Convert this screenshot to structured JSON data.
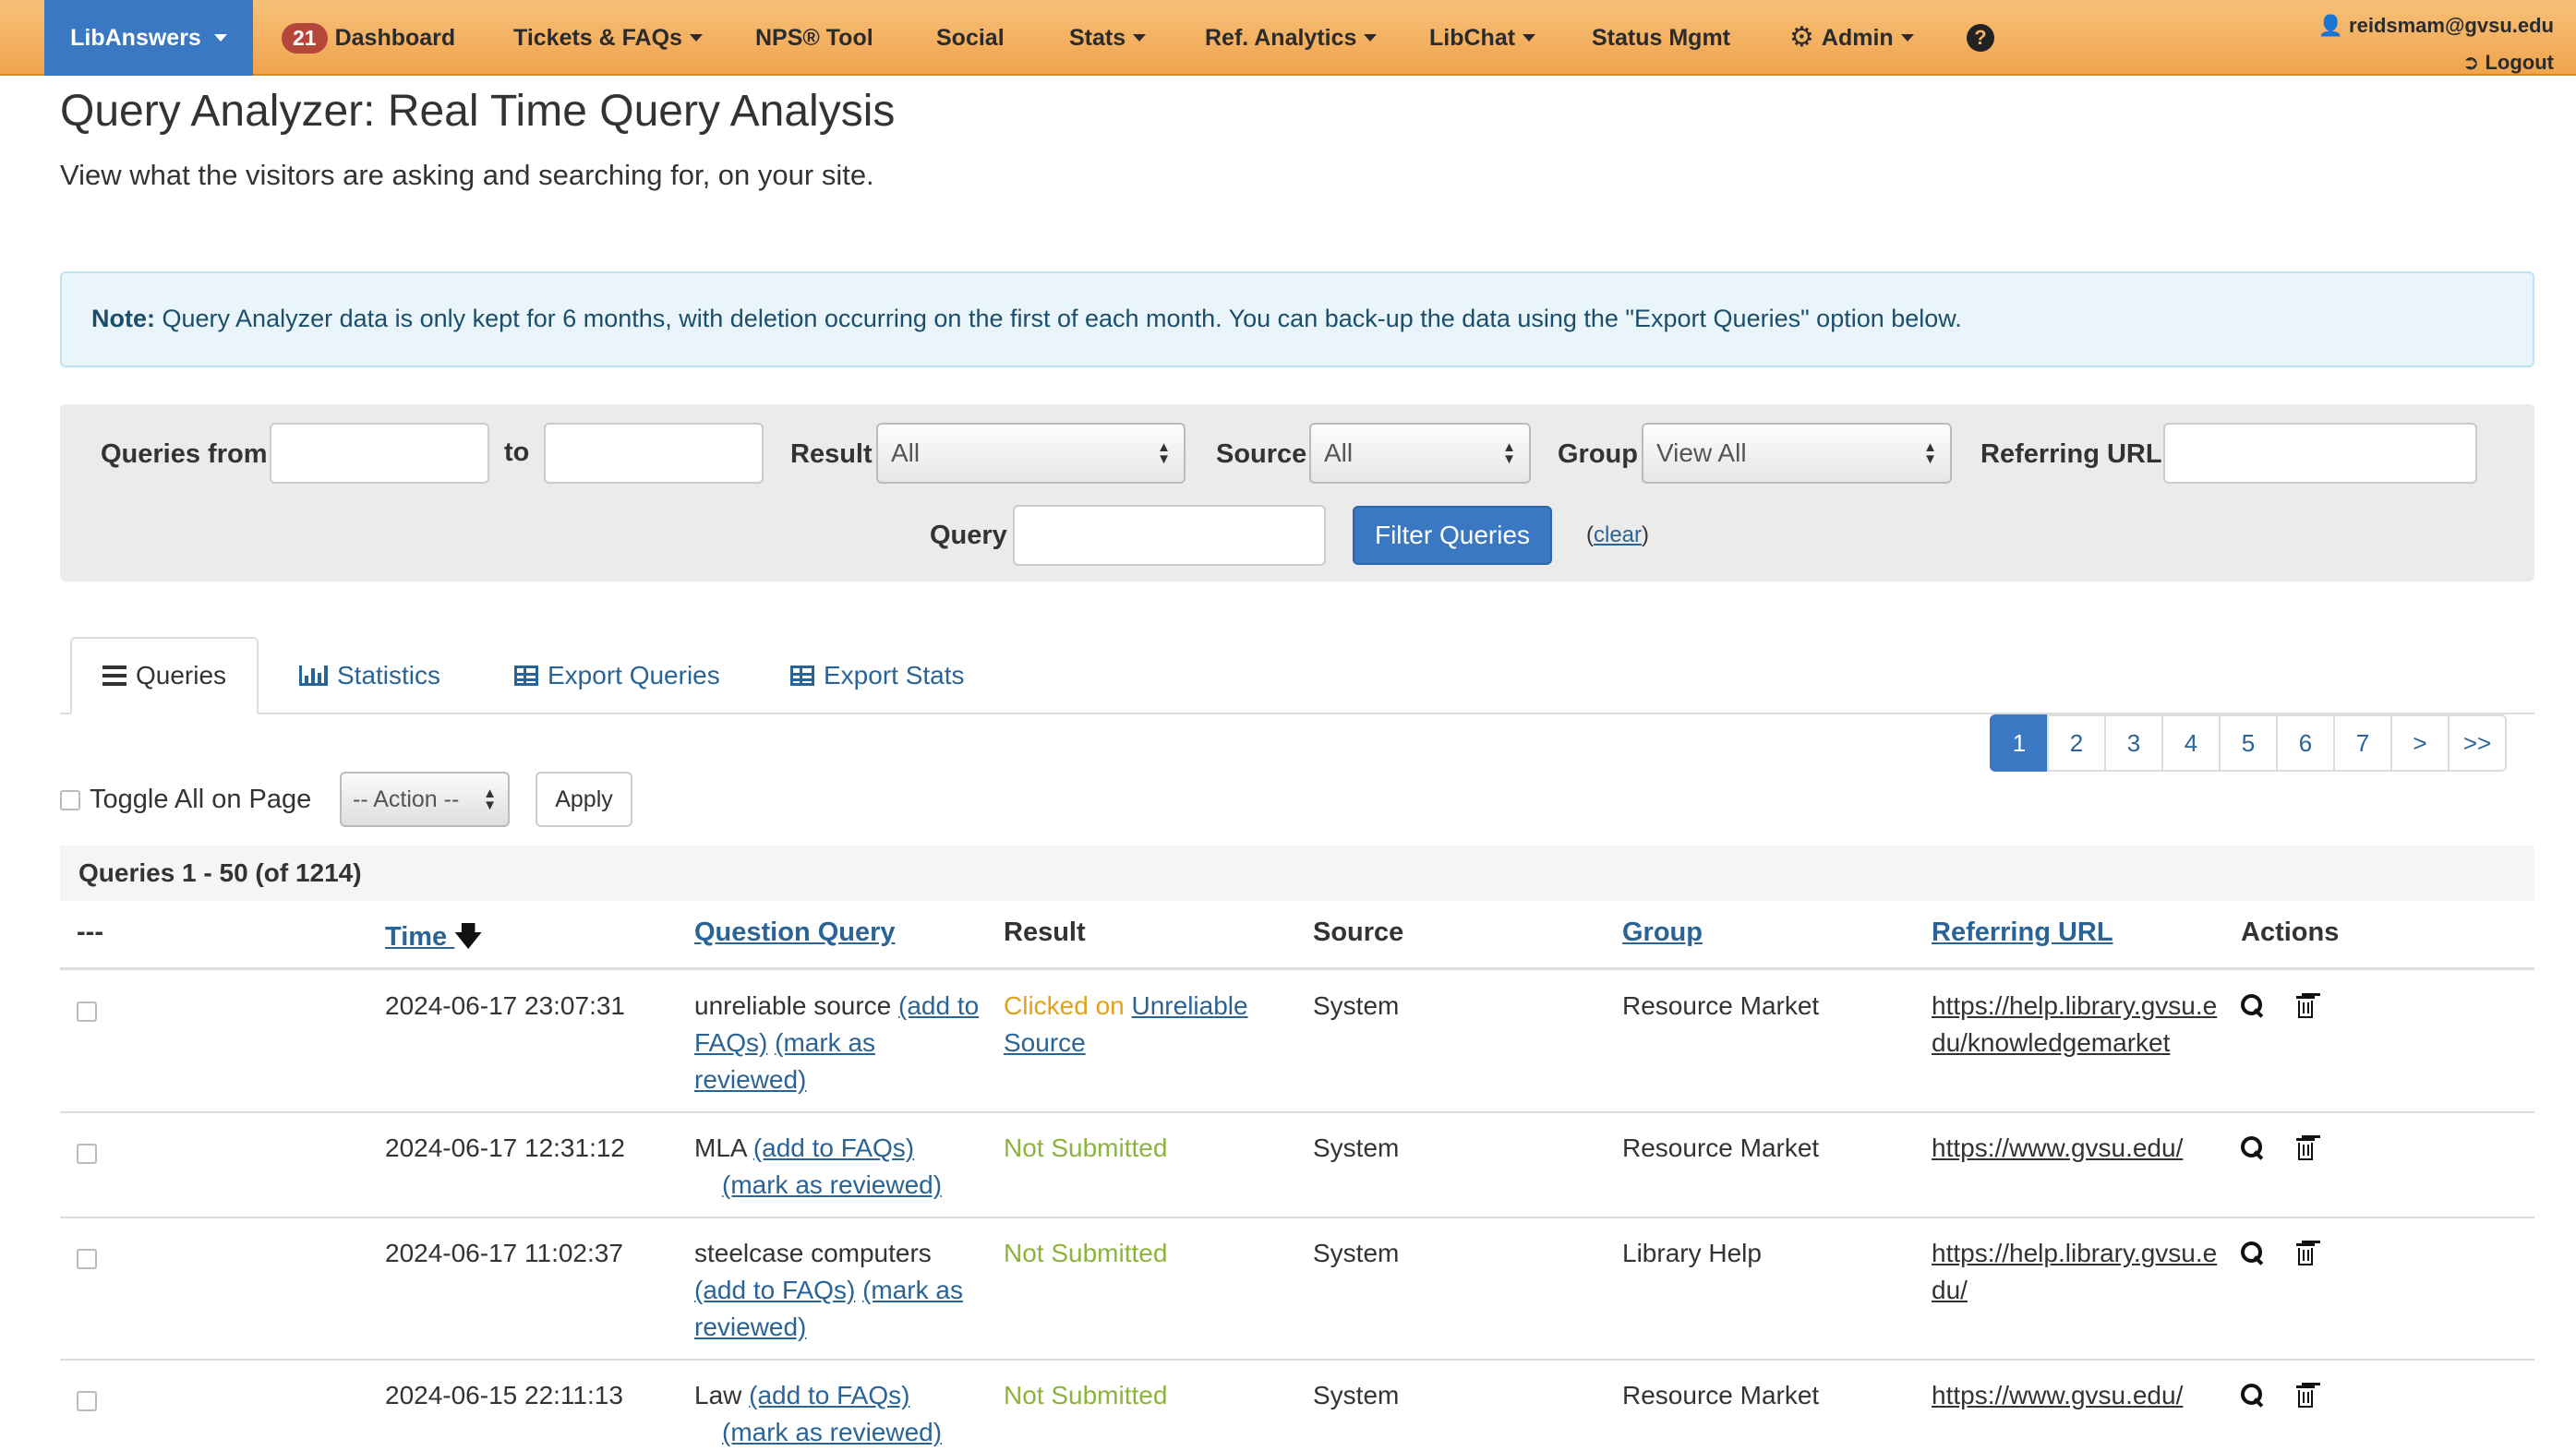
{
  "navbar": {
    "brand": "LibAnswers",
    "dashboard_badge": "21",
    "items": [
      {
        "label": "Dashboard"
      },
      {
        "label": "Tickets & FAQs"
      },
      {
        "label": "NPS® Tool"
      },
      {
        "label": "Social"
      },
      {
        "label": "Stats"
      },
      {
        "label": "Ref. Analytics"
      },
      {
        "label": "LibChat"
      },
      {
        "label": "Status Mgmt"
      },
      {
        "label": "Admin"
      }
    ],
    "help_symbol": "?",
    "user_email": "reidsmam@gvsu.edu",
    "logout_label": "Logout"
  },
  "page": {
    "title": "Query Analyzer: Real Time Query Analysis",
    "subtitle": "View what the visitors are asking and searching for, on your site."
  },
  "note": {
    "label": "Note:",
    "text": " Query Analyzer data is only kept for 6 months, with deletion occurring on the first of each month. You can back-up the data using the \"Export Queries\" option below."
  },
  "filter": {
    "queries_from_label": "Queries from",
    "from_value": "",
    "to_label": "to",
    "to_value": "",
    "result_label": "Result",
    "result_value": "All",
    "source_label": "Source",
    "source_value": "All",
    "group_label": "Group",
    "group_value": "View All",
    "referring_url_label": "Referring URL",
    "referring_url_value": "",
    "query_label": "Query",
    "query_value": "",
    "filter_button": "Filter Queries",
    "clear_open": "(",
    "clear_label": "clear",
    "clear_close": ")"
  },
  "tabs": [
    {
      "label": "Queries",
      "active": true
    },
    {
      "label": "Statistics",
      "active": false
    },
    {
      "label": "Export Queries",
      "active": false
    },
    {
      "label": "Export Stats",
      "active": false
    }
  ],
  "pagination": {
    "pages": [
      "1",
      "2",
      "3",
      "4",
      "5",
      "6",
      "7",
      ">",
      ">>"
    ],
    "active": "1"
  },
  "toolbar": {
    "toggle_all_label": "Toggle All on Page",
    "action_value": "-- Action --",
    "apply_label": "Apply"
  },
  "table": {
    "summary": "Queries 1 - 50 (of 1214)",
    "headers": {
      "select": "---",
      "time": "Time",
      "question_query": "Question Query",
      "result": "Result",
      "source": "Source",
      "group": "Group",
      "referring_url": "Referring URL",
      "actions": "Actions"
    },
    "add_to_faqs": "(add to FAQs)",
    "mark_reviewed": "(mark as reviewed)",
    "rows": [
      {
        "time": "2024-06-17 23:07:31",
        "query": "unreliable source",
        "result_prefix": "Clicked on",
        "result_link": "Unreliable Source",
        "result_status": "clicked",
        "source": "System",
        "group": "Resource Market",
        "referring_url": "https://help.library.gvsu.edu/knowledgemarket"
      },
      {
        "time": "2024-06-17 12:31:12",
        "query": "MLA",
        "result_prefix": "Not Submitted",
        "result_link": "",
        "result_status": "not-submitted",
        "source": "System",
        "group": "Resource Market",
        "referring_url": "https://www.gvsu.edu/"
      },
      {
        "time": "2024-06-17 11:02:37",
        "query": "steelcase computers",
        "result_prefix": "Not Submitted",
        "result_link": "",
        "result_status": "not-submitted",
        "source": "System",
        "group": "Library Help",
        "referring_url": "https://help.library.gvsu.edu/"
      },
      {
        "time": "2024-06-15 22:11:13",
        "query": "Law",
        "result_prefix": "Not Submitted",
        "result_link": "",
        "result_status": "not-submitted",
        "source": "System",
        "group": "Resource Market",
        "referring_url": "https://www.gvsu.edu/"
      }
    ]
  },
  "colors": {
    "navbar": "#f0a44e",
    "brand": "#3a78c3",
    "link": "#2a6496",
    "not_submitted": "#8cb33d",
    "clicked": "#e0a21a",
    "badge": "#b5473a"
  }
}
